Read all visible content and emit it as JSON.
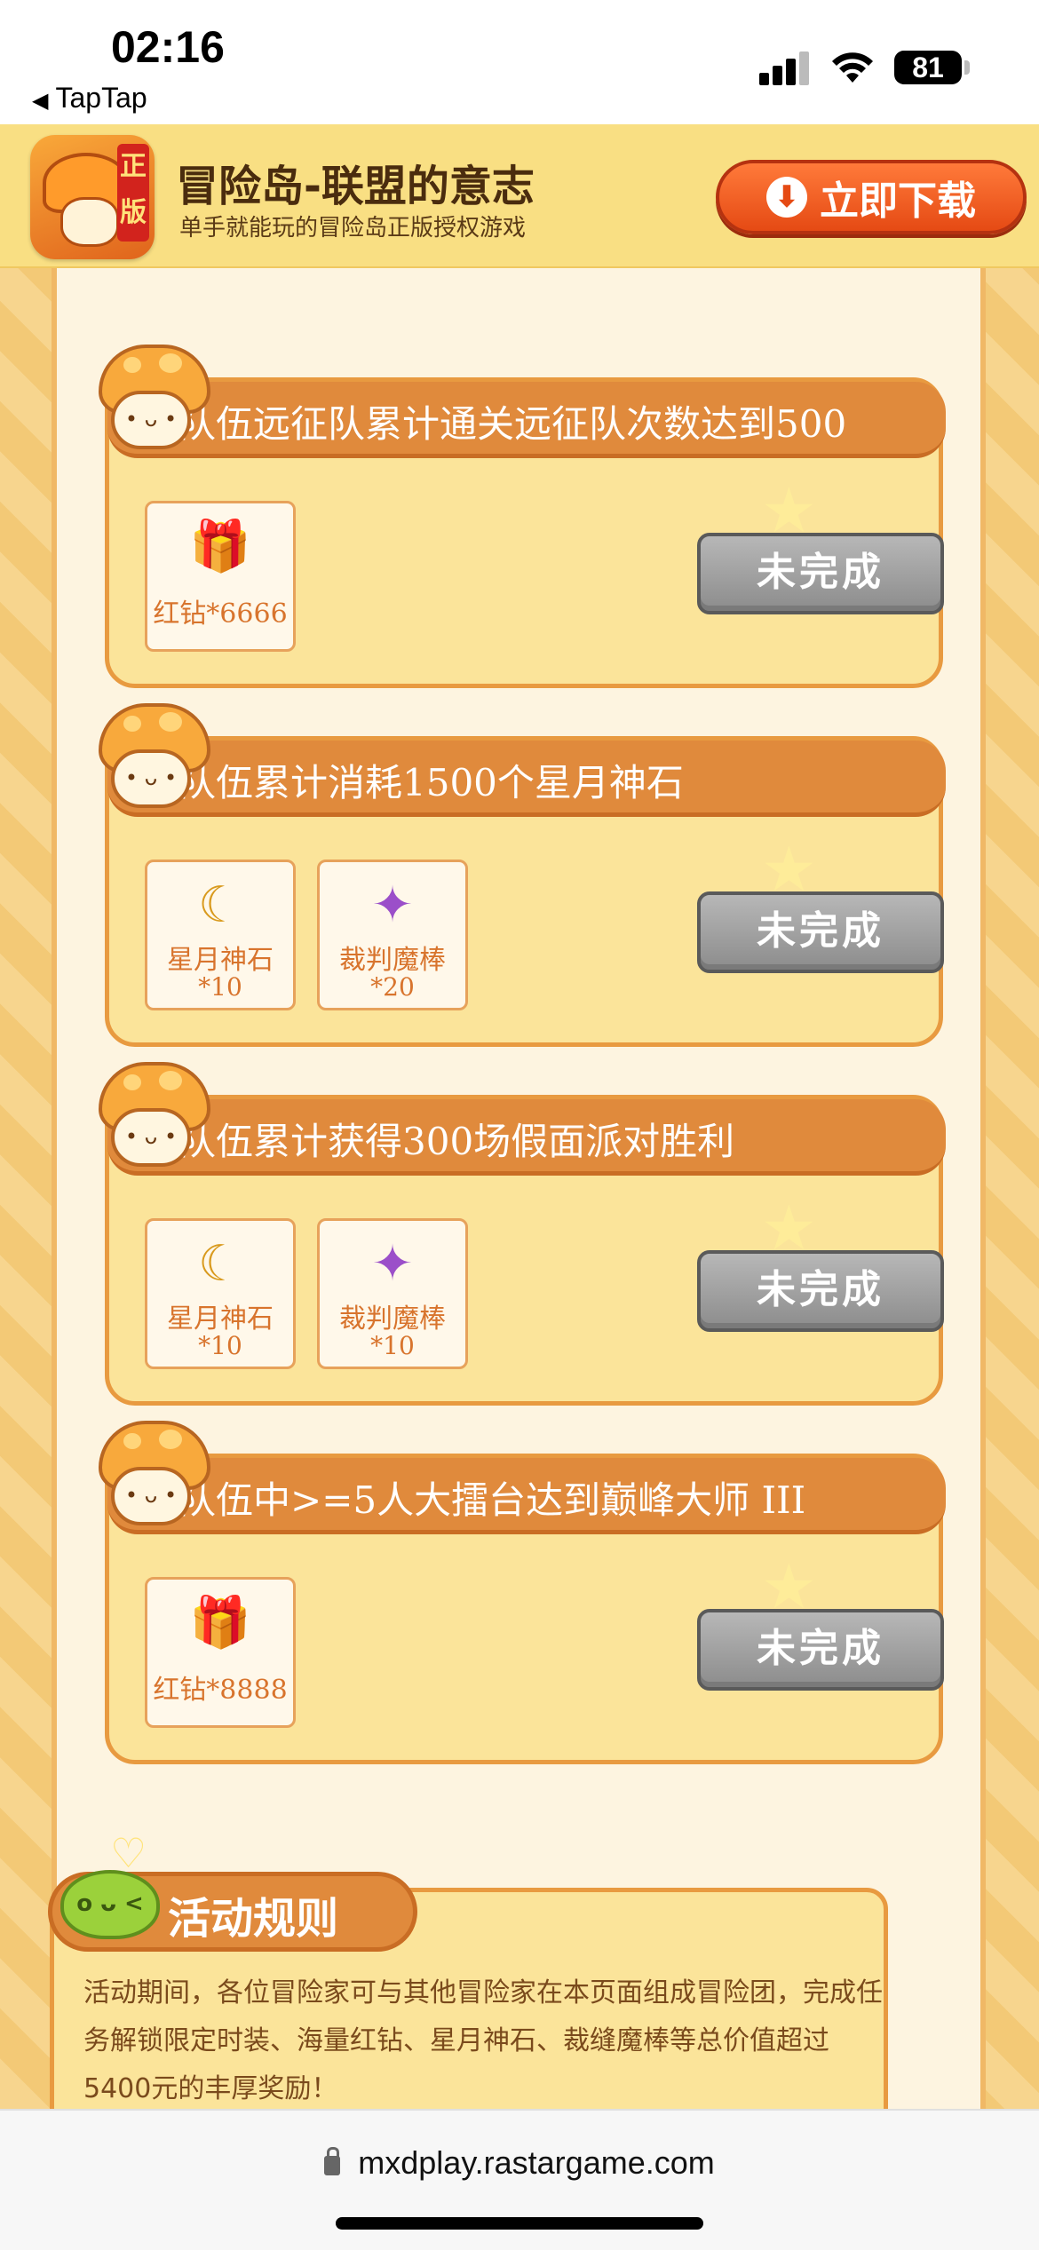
{
  "status_bar": {
    "time": "02:16",
    "back_app": "TapTap",
    "battery": "81"
  },
  "banner": {
    "icon_badge": "正版",
    "title": "冒险岛-联盟的意志",
    "subtitle": "单手就能玩的冒险岛正版授权游戏",
    "download_label": "立即下载"
  },
  "tasks": [
    {
      "title": "队伍远征队累计通关远征队次数达到500",
      "rewards": [
        {
          "icon": "red-diamond-chest-icon",
          "name": "红钻*6666",
          "qty": ""
        }
      ],
      "status": "未完成"
    },
    {
      "title": "队伍累计消耗1500个星月神石",
      "rewards": [
        {
          "icon": "moon-stone-icon",
          "name": "星月神石",
          "qty": "*10"
        },
        {
          "icon": "judgment-wand-icon",
          "name": "裁判魔棒",
          "qty": "*20"
        }
      ],
      "status": "未完成"
    },
    {
      "title": "队伍累计获得300场假面派对胜利",
      "rewards": [
        {
          "icon": "moon-stone-icon",
          "name": "星月神石",
          "qty": "*10"
        },
        {
          "icon": "judgment-wand-icon",
          "name": "裁判魔棒",
          "qty": "*10"
        }
      ],
      "status": "未完成"
    },
    {
      "title": "队伍中>=5人大擂台达到巅峰大师 III",
      "rewards": [
        {
          "icon": "red-diamond-chest-icon",
          "name": "红钻*8888",
          "qty": ""
        }
      ],
      "status": "未完成"
    }
  ],
  "rules": {
    "title": "活动规则",
    "text": "活动期间，各位冒险家可与其他冒险家在本页面组成冒险团，完成任务解锁限定时装、海量红钻、星月神石、裁缝魔棒等总价值超过5400元的丰厚奖励！"
  },
  "url_bar": {
    "url": "mxdplay.rastargame.com"
  }
}
